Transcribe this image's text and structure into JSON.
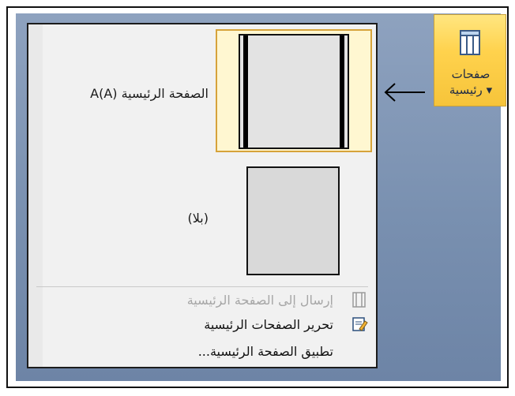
{
  "ribbon": {
    "line1": "صفحات",
    "line2": "رئيسية ▾"
  },
  "gallery": {
    "items": [
      {
        "label": "الصفحة الرئيسية  A(A)"
      },
      {
        "label": "(بلا)"
      }
    ]
  },
  "commands": {
    "send_to_master": "إرسال إلى الصفحة الرئيسية",
    "edit_masters": "تحرير الصفحات الرئيسية",
    "apply_master": "تطبيق الصفحة الرئيسية..."
  },
  "colors": {
    "ribbon_button": "#ffd24d",
    "selection_border": "#d6a33a",
    "background": "#7990b0"
  }
}
